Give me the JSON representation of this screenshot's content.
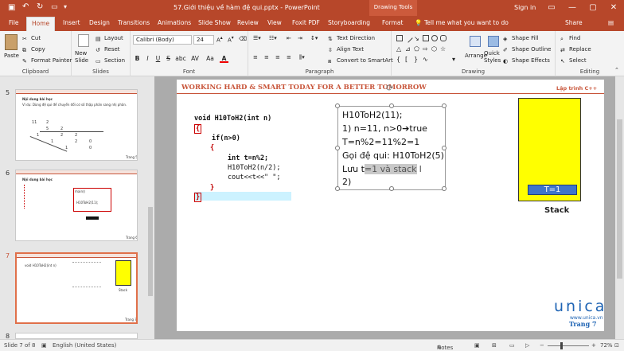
{
  "titlebar": {
    "doc_title": "57.Giới thiệu về hàm đệ qui.pptx  -  PowerPoint",
    "drawing_tools": "Drawing Tools",
    "sign_in": "Sign in"
  },
  "tabs": [
    "File",
    "Home",
    "Insert",
    "Design",
    "Transitions",
    "Animations",
    "Slide Show",
    "Review",
    "View",
    "Foxit PDF",
    "Storyboarding",
    "Format"
  ],
  "tell_me": "Tell me what you want to do",
  "share": "Share",
  "ribbon": {
    "clipboard": {
      "paste": "Paste",
      "cut": "Cut",
      "copy": "Copy",
      "format_painter": "Format Painter",
      "label": "Clipboard"
    },
    "slides": {
      "new_slide": "New Slide",
      "layout": "Layout",
      "reset": "Reset",
      "section": "Section",
      "label": "Slides"
    },
    "font": {
      "name": "Calibri (Body)",
      "size": "24",
      "label": "Font",
      "bold": "B",
      "italic": "I",
      "underline": "U",
      "strike": "S",
      "shadow": "abc",
      "spacing": "AV",
      "case": "Aa",
      "color": "A"
    },
    "paragraph": {
      "text_direction": "Text Direction",
      "align_text": "Align Text",
      "convert_smartart": "Convert to SmartArt",
      "label": "Paragraph"
    },
    "drawing": {
      "arrange": "Arrange",
      "quick_styles": "Quick Styles",
      "shape_fill": "Shape Fill",
      "shape_outline": "Shape Outline",
      "shape_effects": "Shape Effects",
      "label": "Drawing"
    },
    "editing": {
      "find": "Find",
      "replace": "Replace",
      "select": "Select",
      "label": "Editing"
    }
  },
  "thumbnails": [
    {
      "num": "5",
      "heading": "Nội dung bài học",
      "line1": "Ví dụ: Dùng đệ qui để chuyển đổi cơ số thập phân sang nhị phân.",
      "digits": [
        "11",
        "2",
        "5",
        "2",
        "1",
        "2",
        "2",
        "1",
        "2",
        "0",
        "1",
        "0"
      ],
      "page": "Trang 5"
    },
    {
      "num": "6",
      "heading": "Nội dung bài học",
      "code_main": "main()",
      "code_call": "H10ToH2(11);",
      "page": "Trang 6"
    },
    {
      "num": "7",
      "code": "void H10ToH2(int n)",
      "stack": "Stack",
      "page": "Trang 7"
    },
    {
      "num": "8"
    }
  ],
  "slide": {
    "header": "WORKING HARD & SMART TODAY FOR A BETTER TOMORROW",
    "brand": "Lập trình C++",
    "code": {
      "l1": "void H10ToH2(int n)",
      "l2": "{",
      "l3": "if(n>0)",
      "l4": "{",
      "l5": "int t=n%2;",
      "l6": "H10ToH2(n/2);",
      "l7": "cout<<t<<\" \";",
      "l8": "}",
      "l9": "}"
    },
    "textbox": {
      "t1": "H10ToH2(11);",
      "t2": "1)    n=11, n>0",
      "t2b": "true",
      "t3": "T=n%2=11%2=1",
      "t4": "Gọi đệ qui: H10ToH2(5)",
      "t5a": "Lưu t",
      "t5b": "=1 và stack",
      "t6": "2)"
    },
    "stack_value": "T=1",
    "stack_label": "Stack",
    "logo": "unica",
    "logo_url": "www.unica.vn",
    "page": "Trang 7"
  },
  "status": {
    "slide_of": "Slide 7 of 8",
    "language": "English (United States)",
    "notes": "Notes",
    "zoom": "72%"
  },
  "colors": {
    "accent": "#b7472a",
    "stack_fill": "#ffff00",
    "stack_item": "#3f75c9",
    "brace": "#c00000",
    "highlight": "#ccf2ff"
  }
}
